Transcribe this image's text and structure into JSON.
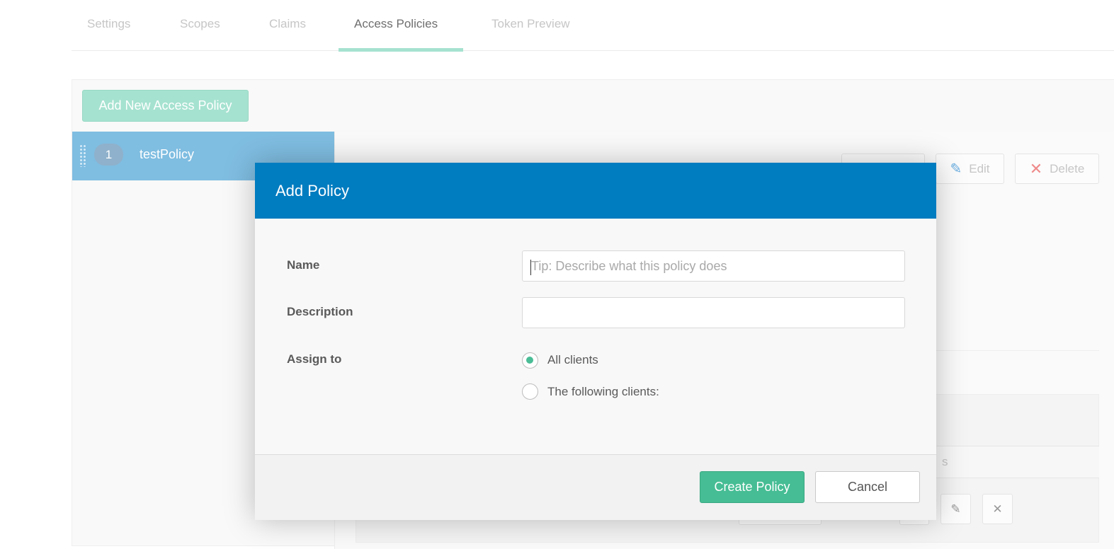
{
  "tabs": [
    {
      "label": "Settings"
    },
    {
      "label": "Scopes"
    },
    {
      "label": "Claims"
    },
    {
      "label": "Access Policies",
      "active": true
    },
    {
      "label": "Token Preview"
    }
  ],
  "toolbar": {
    "add_label": "Add New Access Policy"
  },
  "policies": [
    {
      "index": "1",
      "name": "testPolicy"
    }
  ],
  "policy_actions": {
    "edit_label": "Edit",
    "delete_label": "Delete"
  },
  "background_table": {
    "header_fragment": "s"
  },
  "dialog": {
    "title": "Add Policy",
    "name_label": "Name",
    "name_placeholder": "Tip: Describe what this policy does",
    "name_value": "",
    "description_label": "Description",
    "description_value": "",
    "assign_label": "Assign to",
    "assign_options": [
      {
        "label": "All clients",
        "selected": true
      },
      {
        "label": "The following clients:",
        "selected": false
      }
    ],
    "create_label": "Create Policy",
    "cancel_label": "Cancel"
  },
  "colors": {
    "header": "#007cc0",
    "primary": "#46bd94",
    "selected_item": "#7fbde1"
  }
}
